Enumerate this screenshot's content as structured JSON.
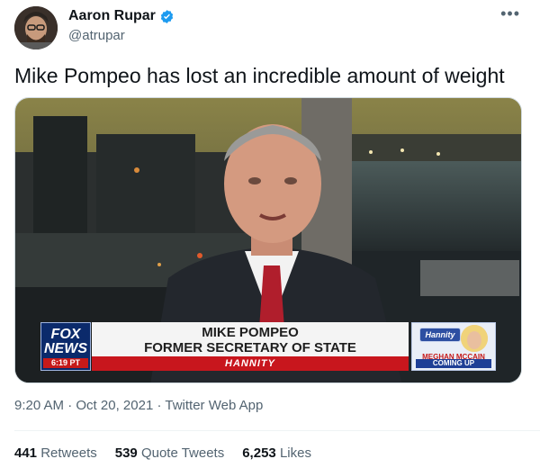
{
  "author": {
    "name": "Aaron Rupar",
    "handle": "@atrupar",
    "verified": true,
    "avatar_icon": "avatar-icon"
  },
  "tweet": {
    "text": "Mike Pompeo has lost an incredible amount of weight"
  },
  "media": {
    "network_logo_line1": "FOX",
    "network_logo_line2": "NEWS",
    "time_badge": "6:19 PT",
    "chyron_name": "MIKE POMPEO",
    "chyron_title": "FORMER SECRETARY OF STATE",
    "show_bar": "HANNITY",
    "promo_show": "Hannity",
    "promo_guest": "MEGHAN MCCAIN",
    "promo_coming": "COMING UP"
  },
  "meta": {
    "time": "9:20 AM",
    "date": "Oct 20, 2021",
    "separator": "·",
    "source": "Twitter Web App"
  },
  "stats": {
    "retweets_count": "441",
    "retweets_label": "Retweets",
    "quotes_count": "539",
    "quotes_label": "Quote Tweets",
    "likes_count": "6,253",
    "likes_label": "Likes"
  },
  "colors": {
    "text": "#0f1419",
    "muted": "#536471",
    "verified": "#1d9bf0",
    "fox_blue": "#0b2a6b",
    "fox_red": "#c8161d"
  }
}
